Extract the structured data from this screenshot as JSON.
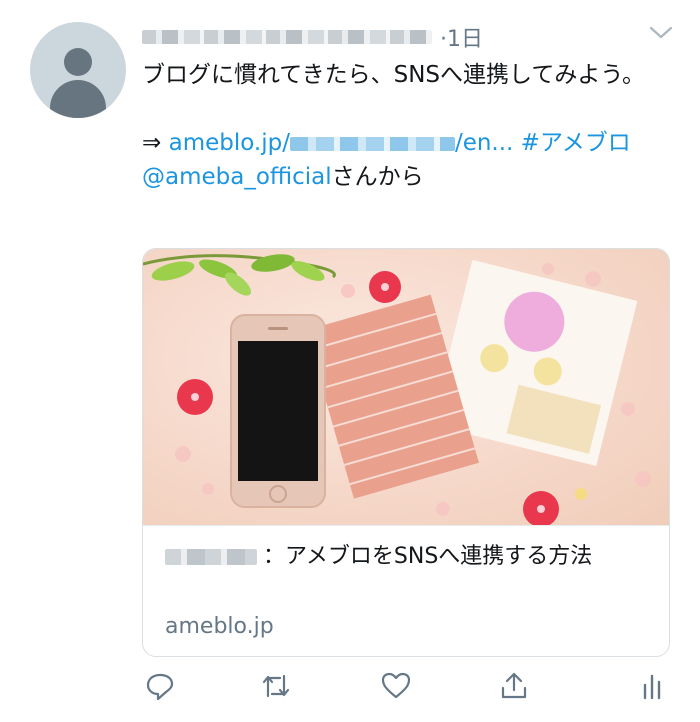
{
  "tweet": {
    "time": "·1日",
    "text_line1": "ブログに慣れてきたら、SNSへ連携してみよう。",
    "link_prefix": "⇒ ",
    "link_start": "ameblo.jp/",
    "link_end": "/en...",
    "hashtag": " #アメブロ",
    "mention": "@ameba_official",
    "mention_suffix": "さんから"
  },
  "card": {
    "title_suffix": "：アメブロをSNSへ連携する方法",
    "domain": "ameblo.jp"
  },
  "icons": [
    "chevron-down-icon",
    "reply-icon",
    "retweet-icon",
    "like-icon",
    "share-icon",
    "analytics-icon"
  ],
  "colors": {
    "link": "#1b95e0",
    "secondary": "#657786",
    "border": "#d9dfe3"
  }
}
